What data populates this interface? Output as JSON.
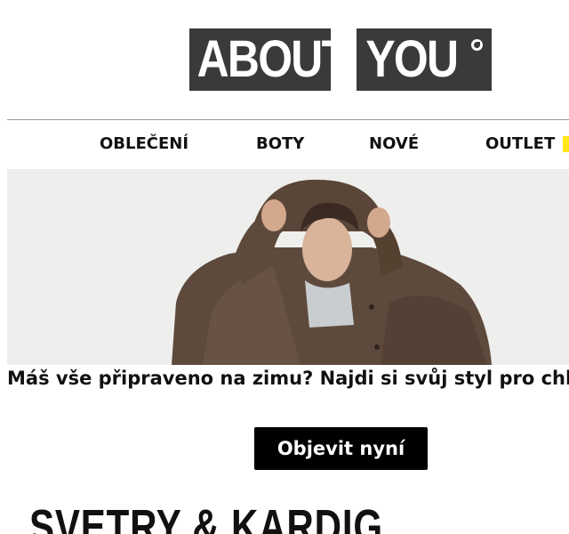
{
  "logo": {
    "part1": "ABOUT",
    "part2": "YOU"
  },
  "nav": {
    "items": [
      {
        "label": "OBLEČENÍ"
      },
      {
        "label": "BOTY"
      },
      {
        "label": "NOVÉ"
      },
      {
        "label": "OUTLET"
      }
    ]
  },
  "hero": {
    "headline": "Máš vše připraveno na zimu? Najdi si svůj styl pro chla",
    "cta_label": "Objevit nyní"
  },
  "section": {
    "heading": "SVETRY & KARDIG"
  },
  "colors": {
    "logo_bg": "#3a3a3a",
    "accent_yellow": "#ffe81a",
    "cta_bg": "#000000"
  }
}
